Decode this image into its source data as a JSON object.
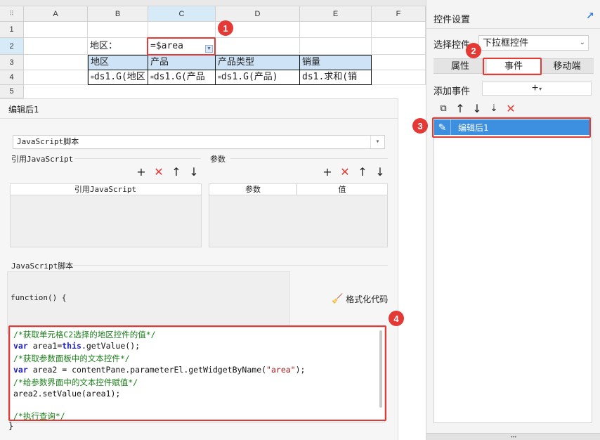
{
  "sheet": {
    "columns": [
      "A",
      "B",
      "C",
      "D",
      "E",
      "F"
    ],
    "rows": [
      "1",
      "2",
      "3",
      "4",
      "5"
    ],
    "b2": "地区：",
    "c2": "=$area",
    "headers": [
      "地区",
      "产品",
      "产品类型",
      "销量"
    ],
    "data": [
      "ds1.G(地区",
      "ds1.G(产品",
      "ds1.G(产品)",
      "ds1.求和(销"
    ],
    "marker": "≡"
  },
  "editor": {
    "title": "编辑后1",
    "script_type": "JavaScript脚本",
    "ref_section": "引用JavaScript",
    "ref_table_header": "引用JavaScript",
    "param_section": "参数",
    "param_headers": [
      "参数",
      "值"
    ],
    "script_section": "JavaScript脚本",
    "function_signature": "function() {",
    "format_button": "格式化代码",
    "closing_brace": "}",
    "code": [
      {
        "text": "/*获取单元格C2选择的地区控件的值*/",
        "type": "comment"
      },
      {
        "kw": "var",
        "text": " area1=",
        "kw2": "this",
        "rest": ".getValue();",
        "type": "code"
      },
      {
        "text": "/*获取参数面板中的文本控件*/",
        "type": "comment"
      },
      {
        "kw": "var",
        "text": " area2 = contentPane.parameterEl.getWidgetByName(",
        "str": "\"area\"",
        "rest": ");",
        "type": "code"
      },
      {
        "text": "/*给参数界面中的文本控件赋值*/",
        "type": "comment"
      },
      {
        "text": "area2.setValue(area1);",
        "type": "plain"
      },
      {
        "text": "",
        "type": "plain"
      },
      {
        "text": "/*执行查询*/",
        "type": "comment"
      }
    ]
  },
  "settings": {
    "title": "控件设置",
    "select_label": "选择控件",
    "select_value": "下拉框控件",
    "tabs": [
      "属性",
      "事件",
      "移动端"
    ],
    "active_tab": "事件",
    "add_event_label": "添加事件",
    "events": [
      "编辑后1"
    ]
  },
  "badges": [
    "1",
    "2",
    "3",
    "4"
  ],
  "colors": {
    "highlight": "#e53935",
    "selected_event": "#3d8fe0",
    "header_cell": "#cfe3f7",
    "comment": "#1a7f1a",
    "keyword": "#1f1fbf"
  }
}
